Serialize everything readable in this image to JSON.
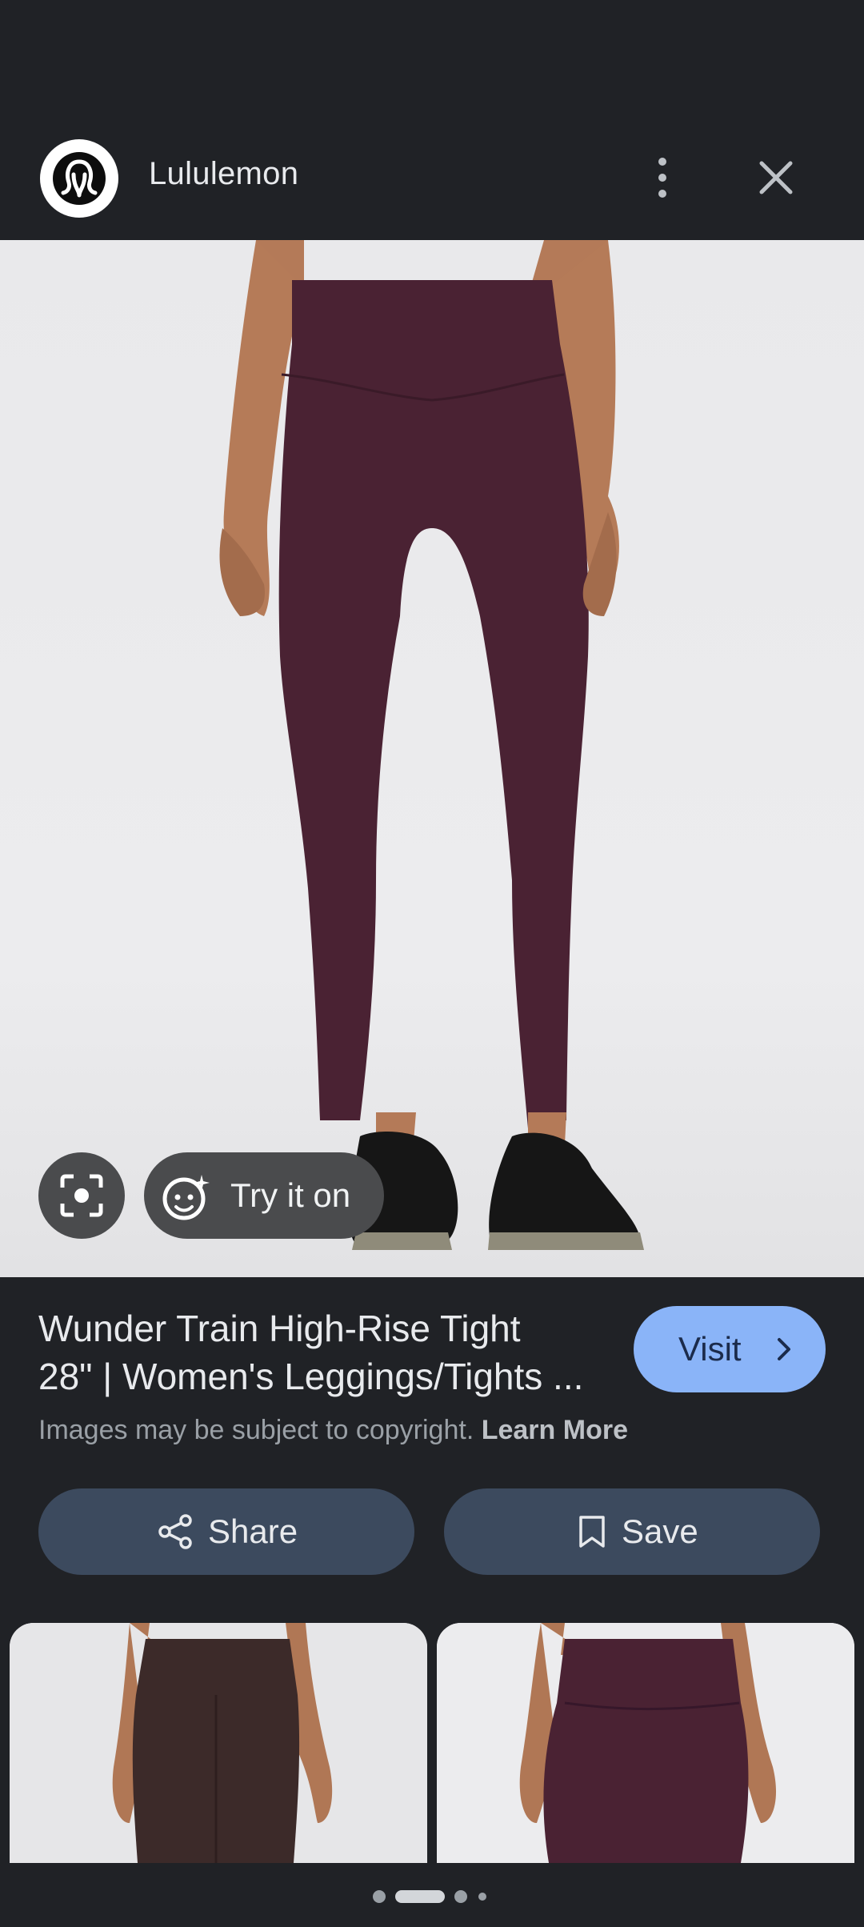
{
  "header": {
    "site_name": "Lululemon",
    "logo_icon": "lululemon-logo-icon",
    "more_icon": "more-vert-icon",
    "close_icon": "close-icon"
  },
  "image": {
    "subject": "leggings-photo",
    "lens_icon": "lens-icon",
    "try_on_label": "Try it on",
    "try_on_icon": "sparkle-face-icon"
  },
  "result": {
    "title_line1": "Wunder Train High-Rise Tight",
    "title_line2": "28\" | Women's Leggings/Tights ...",
    "visit_label": "Visit",
    "copyright_text": "Images may be subject to copyright.",
    "learn_more": "Learn More"
  },
  "actions": {
    "share_label": "Share",
    "save_label": "Save"
  },
  "colors": {
    "background": "#202226",
    "accent": "#8ab4f8",
    "action_button": "#3c4a5e",
    "legging": "#4a2233"
  }
}
